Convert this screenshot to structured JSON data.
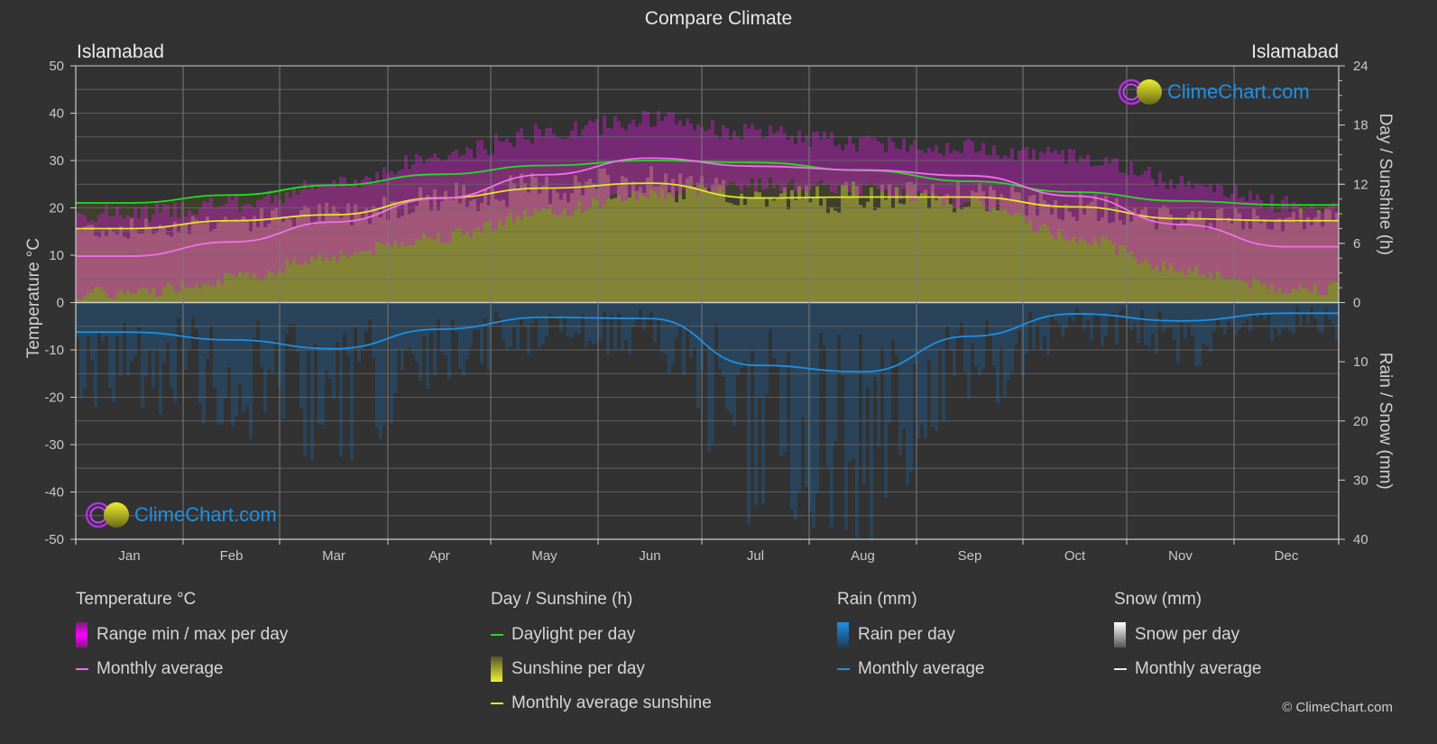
{
  "header": {
    "title": "Compare Climate",
    "city_left": "Islamabad",
    "city_right": "Islamabad"
  },
  "watermark": "ClimeChart.com",
  "copyright": "© ClimeChart.com",
  "colors": {
    "background": "#323232",
    "daylight": "#22dd22",
    "sunshine_avg": "#e6e62a",
    "temp_avg": "#f070e8",
    "rain_avg": "#1e8fe6",
    "temp_range": "#c81ec8",
    "sunshine_fill": "#8c8c38",
    "rain_fill": "#1e5a8c",
    "grid": "#5a5a5a"
  },
  "chart_data": {
    "type": "area",
    "title": "Compare Climate",
    "categories": [
      "Jan",
      "Feb",
      "Mar",
      "Apr",
      "May",
      "Jun",
      "Jul",
      "Aug",
      "Sep",
      "Oct",
      "Nov",
      "Dec"
    ],
    "left_axis": {
      "label": "Temperature °C",
      "range": [
        -50,
        50
      ],
      "ticks": [
        50,
        40,
        30,
        20,
        10,
        0,
        -10,
        -20,
        -30,
        -40,
        -50
      ]
    },
    "right_axis_top": {
      "label": "Day / Sunshine (h)",
      "range": [
        0,
        24
      ],
      "ticks": [
        24,
        18,
        12,
        6,
        0
      ]
    },
    "right_axis_bottom": {
      "label": "Rain / Snow (mm)",
      "range": [
        0,
        40
      ],
      "ticks": [
        0,
        10,
        20,
        30,
        40
      ]
    },
    "grid": true,
    "series": [
      {
        "name": "Daylight per day",
        "axis": "hours",
        "values": [
          10.1,
          10.9,
          11.9,
          13.0,
          13.9,
          14.4,
          14.2,
          13.4,
          12.3,
          11.2,
          10.3,
          9.9
        ]
      },
      {
        "name": "Monthly average sunshine",
        "axis": "hours",
        "values": [
          7.5,
          8.3,
          8.9,
          10.6,
          11.6,
          12.1,
          10.6,
          10.7,
          10.7,
          9.7,
          8.5,
          8.3
        ]
      },
      {
        "name": "Temperature monthly average",
        "axis": "temperature",
        "values": [
          9.8,
          12.8,
          17.0,
          22.0,
          27.0,
          30.5,
          28.8,
          28.0,
          26.8,
          22.5,
          16.5,
          11.8
        ]
      },
      {
        "name": "Temperature max (approx)",
        "axis": "temperature",
        "values": [
          18,
          20,
          24,
          30,
          35,
          38,
          35,
          33,
          32,
          30,
          25,
          20
        ]
      },
      {
        "name": "Temperature min (approx)",
        "axis": "temperature",
        "values": [
          2,
          5,
          10,
          14,
          19,
          23,
          25,
          24,
          21,
          14,
          7,
          3
        ]
      },
      {
        "name": "Rain monthly average",
        "axis": "mm",
        "values": [
          5.0,
          6.3,
          7.8,
          4.5,
          2.5,
          2.7,
          10.6,
          11.7,
          5.7,
          1.9,
          3.1,
          1.8
        ]
      }
    ]
  },
  "legend": {
    "groups": [
      {
        "title": "Temperature °C",
        "items": [
          {
            "label": "Range min / max per day",
            "kind": "bar-magenta"
          },
          {
            "label": "Monthly average",
            "kind": "line-pink"
          }
        ]
      },
      {
        "title": "Day / Sunshine (h)",
        "items": [
          {
            "label": "Daylight per day",
            "kind": "line-green"
          },
          {
            "label": "Sunshine per day",
            "kind": "bar-yellow"
          },
          {
            "label": "Monthly average sunshine",
            "kind": "line-yellow"
          }
        ]
      },
      {
        "title": "Rain (mm)",
        "items": [
          {
            "label": "Rain per day",
            "kind": "bar-blue"
          },
          {
            "label": "Monthly average",
            "kind": "line-blue"
          }
        ]
      },
      {
        "title": "Snow (mm)",
        "items": [
          {
            "label": "Snow per day",
            "kind": "bar-white"
          },
          {
            "label": "Monthly average",
            "kind": "line-white"
          }
        ]
      }
    ]
  }
}
